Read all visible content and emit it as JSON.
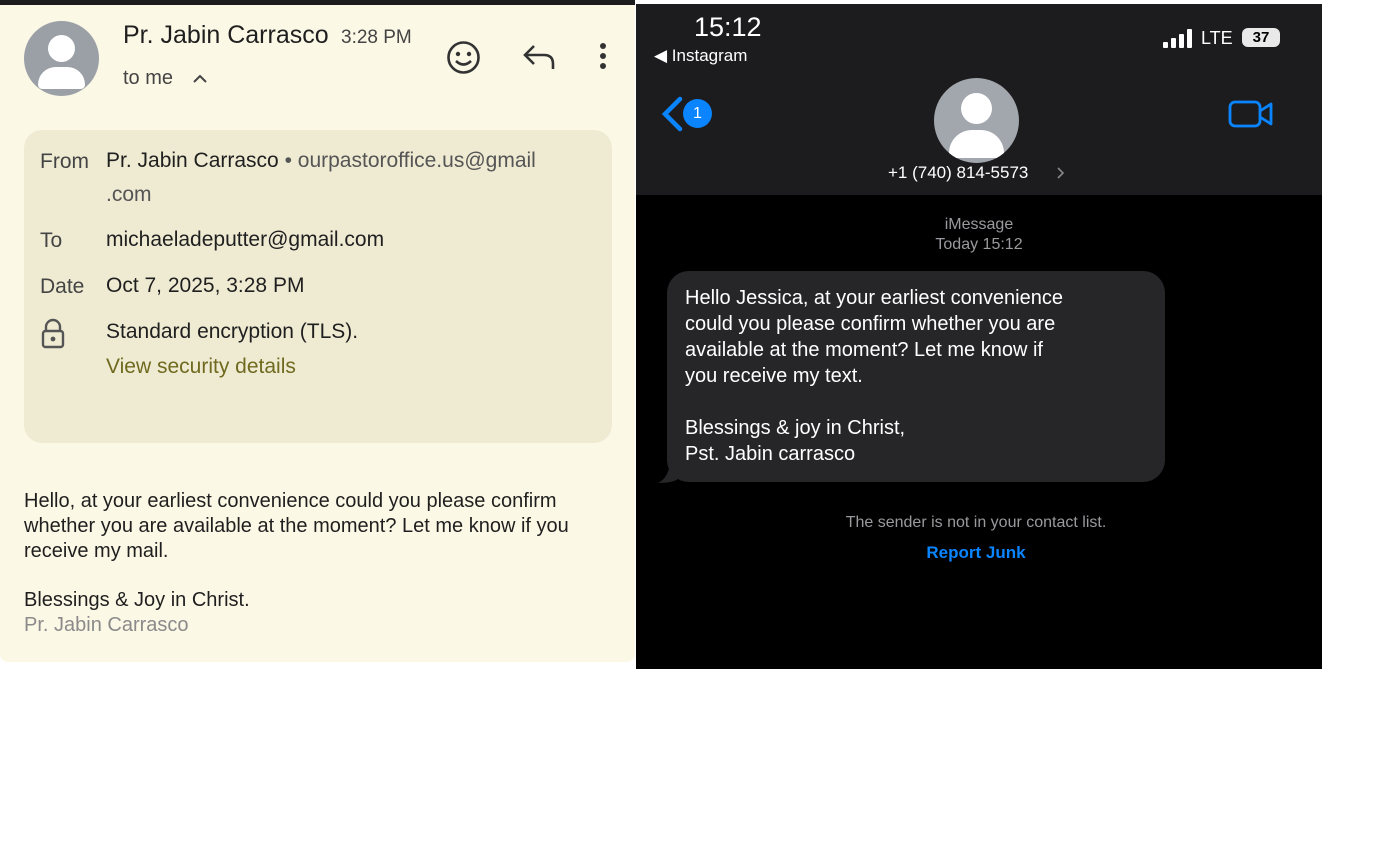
{
  "email": {
    "sender_name": "Pr. Jabin Carrasco",
    "time": "3:28 PM",
    "to_me": "to me",
    "details": {
      "from_label": "From",
      "from_name": "Pr. Jabin Carrasco",
      "from_sep": " • ",
      "from_email_line1": "ourpastoroffice.us@gmail",
      "from_email_line2": ".com",
      "to_label": "To",
      "to_value": "michaeladeputter@gmail.com",
      "date_label": "Date",
      "date_value": "Oct 7, 2025, 3:28 PM",
      "security_text": "Standard encryption (TLS).",
      "security_link": "View security details"
    },
    "body": "Hello, at your earliest convenience could you please confirm whether you are available at the moment? Let me know if you receive my mail.",
    "sign_line1": "Blessings & Joy in Christ.",
    "sign_line2": "Pr. Jabin Carrasco",
    "icons": [
      "avatar-icon",
      "emoji-icon",
      "reply-icon",
      "more-vert-icon",
      "chevron-up-icon",
      "lock-icon"
    ]
  },
  "imessage": {
    "status": {
      "time": "15:12",
      "back_app": "◀ Instagram",
      "network": "LTE",
      "battery": "37"
    },
    "nav": {
      "unread_badge": "1",
      "phone": "+1 (740) 814-5573"
    },
    "service": "iMessage",
    "service_time": "Today 15:12",
    "message_lines": [
      "Hello Jessica, at your earliest convenience",
      "could you please confirm whether you are",
      "available at the moment? Let me know if",
      "you receive my text.",
      "",
      "Blessings & joy in Christ,",
      "Pst. Jabin carrasco"
    ],
    "not_contact": "The sender is not in your contact list.",
    "report_junk": "Report Junk",
    "colors": {
      "accent": "#0a84ff",
      "bubble": "#262629",
      "background": "#000000"
    },
    "icons": [
      "back-chevron-icon",
      "contact-avatar-icon",
      "video-call-icon",
      "signal-bars-icon",
      "battery-icon"
    ]
  }
}
